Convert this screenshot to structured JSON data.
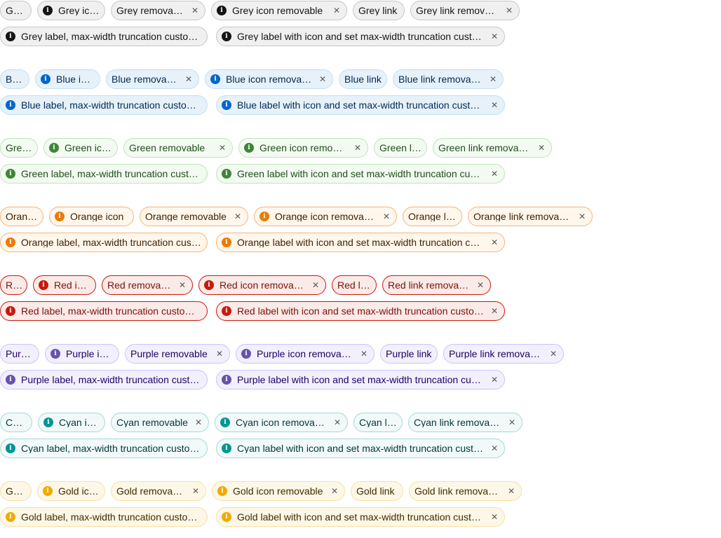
{
  "groups": [
    {
      "id": "grey",
      "colors": {
        "bg": "#f0f0f0",
        "border": "#c7c7c7",
        "text": "#151515",
        "icon": "#151515"
      },
      "row1": [
        "Grey",
        "Grey icon",
        "Grey removable",
        "Grey icon removable",
        "Grey link",
        "Grey link removable"
      ],
      "row2": [
        "Grey label, max-width truncation customized",
        "Grey label with icon and set max-width truncation customized"
      ]
    },
    {
      "id": "blue",
      "colors": {
        "bg": "#e7f1fa",
        "border": "#bee1f4",
        "text": "#002952",
        "icon": "#0066cc"
      },
      "row1": [
        "Blue",
        "Blue icon",
        "Blue removable",
        "Blue icon removable",
        "Blue link",
        "Blue link removable"
      ],
      "row2": [
        "Blue label, max-width truncation customized",
        "Blue label with icon and set max-width truncation customized"
      ]
    },
    {
      "id": "green",
      "colors": {
        "bg": "#f3faf2",
        "border": "#bde5b8",
        "text": "#1e4f18",
        "icon": "#3e8635"
      },
      "row1": [
        "Green",
        "Green icon",
        "Green removable",
        "Green icon removable",
        "Green link",
        "Green link removable"
      ],
      "row2": [
        "Green label, max-width truncation customized",
        "Green label with icon and set max-width truncation customized"
      ]
    },
    {
      "id": "orange",
      "colors": {
        "bg": "#fff6ec",
        "border": "#f4b678",
        "text": "#3b1f00",
        "icon": "#ec7a08"
      },
      "row1": [
        "Orange",
        "Orange icon",
        "Orange removable",
        "Orange icon removable",
        "Orange link",
        "Orange link removable"
      ],
      "row2": [
        "Orange label, max-width truncation customized",
        "Orange label with icon and set max-width truncation customized"
      ]
    },
    {
      "id": "red",
      "colors": {
        "bg": "#faeae8",
        "border": "#c9190b",
        "text": "#7d1007",
        "icon": "#c9190b"
      },
      "row1": [
        "Red",
        "Red icon",
        "Red removable",
        "Red icon removable",
        "Red link",
        "Red link removable"
      ],
      "row2": [
        "Red label, max-width truncation customized",
        "Red label with icon and set max-width truncation customized"
      ]
    },
    {
      "id": "purple",
      "colors": {
        "bg": "#f2f0fc",
        "border": "#cbc1ff",
        "text": "#1f0066",
        "icon": "#6753ac"
      },
      "row1": [
        "Purple",
        "Purple icon",
        "Purple removable",
        "Purple icon removable",
        "Purple link",
        "Purple link removable"
      ],
      "row2": [
        "Purple label, max-width truncation customized",
        "Purple label with icon and set max-width truncation customized"
      ]
    },
    {
      "id": "cyan",
      "colors": {
        "bg": "#f2f9f9",
        "border": "#a2d9d9",
        "text": "#003737",
        "icon": "#009596"
      },
      "row1": [
        "Cyan",
        "Cyan icon",
        "Cyan removable",
        "Cyan icon removable",
        "Cyan link",
        "Cyan link removable"
      ],
      "row2": [
        "Cyan label, max-width truncation customized",
        "Cyan label with icon and set max-width truncation customized"
      ]
    },
    {
      "id": "gold",
      "colors": {
        "bg": "#fdf7e7",
        "border": "#f9e0a2",
        "text": "#3d2c00",
        "icon": "#f0ab00"
      },
      "row1": [
        "Gold",
        "Gold icon",
        "Gold removable",
        "Gold icon removable",
        "Gold link",
        "Gold link removable"
      ],
      "row2": [
        "Gold label, max-width truncation customized",
        "Gold label with icon and set max-width truncation customized"
      ]
    }
  ]
}
